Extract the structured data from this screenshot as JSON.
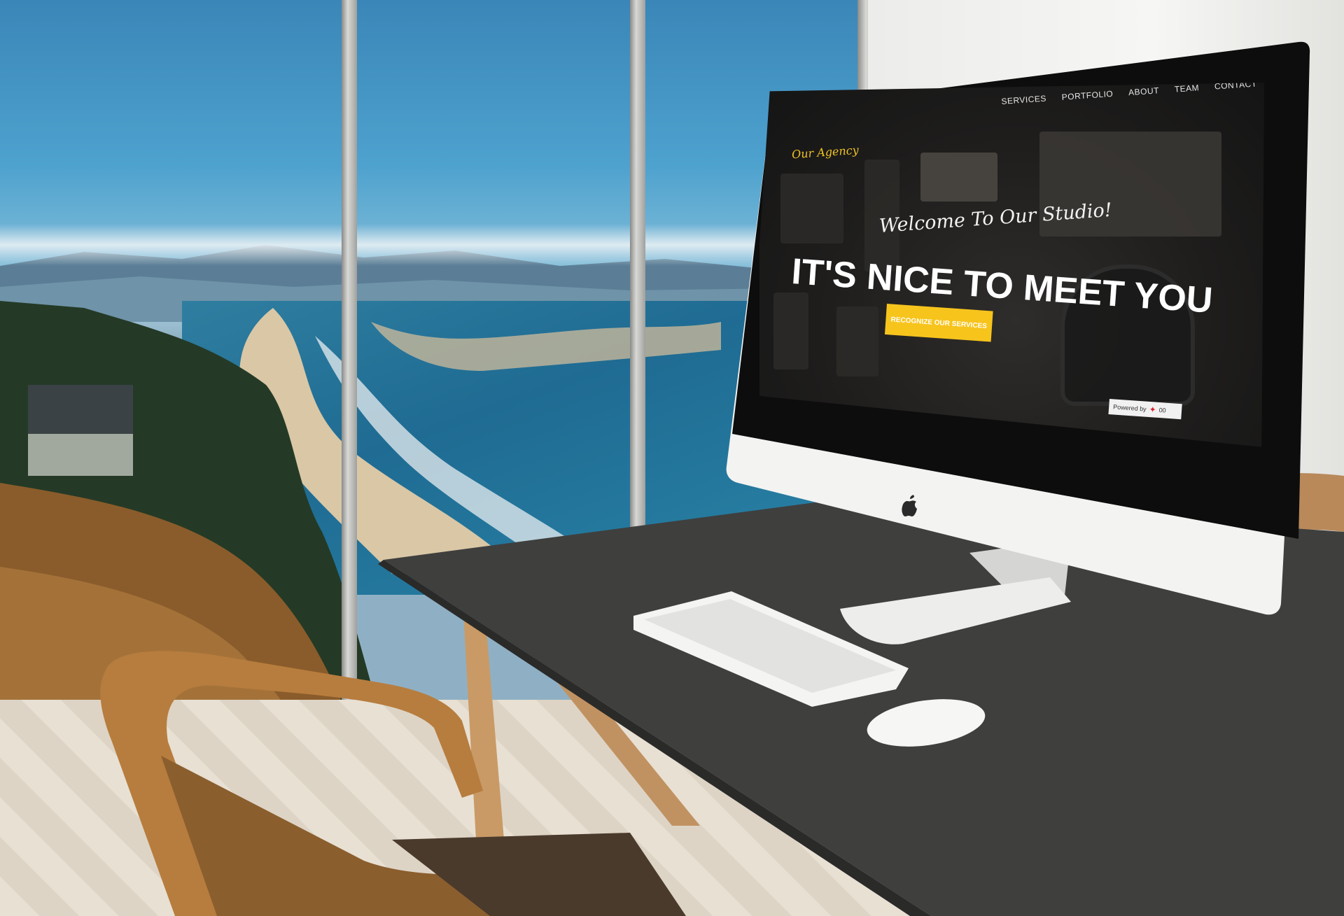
{
  "site": {
    "brand": "Our Agency",
    "nav": [
      "SERVICES",
      "PORTFOLIO",
      "ABOUT",
      "TEAM",
      "CONTACT"
    ],
    "welcome": "Welcome To Our Studio!",
    "headline": "IT'S NICE TO MEET YOU",
    "cta_label": "RECOGNIZE OUR SERVICES",
    "powered_label": "Powered by",
    "powered_suffix": "00"
  },
  "colors": {
    "accent": "#f7c41c",
    "screen_bg": "#1e1d1c",
    "desk": "#3f3f3e"
  }
}
